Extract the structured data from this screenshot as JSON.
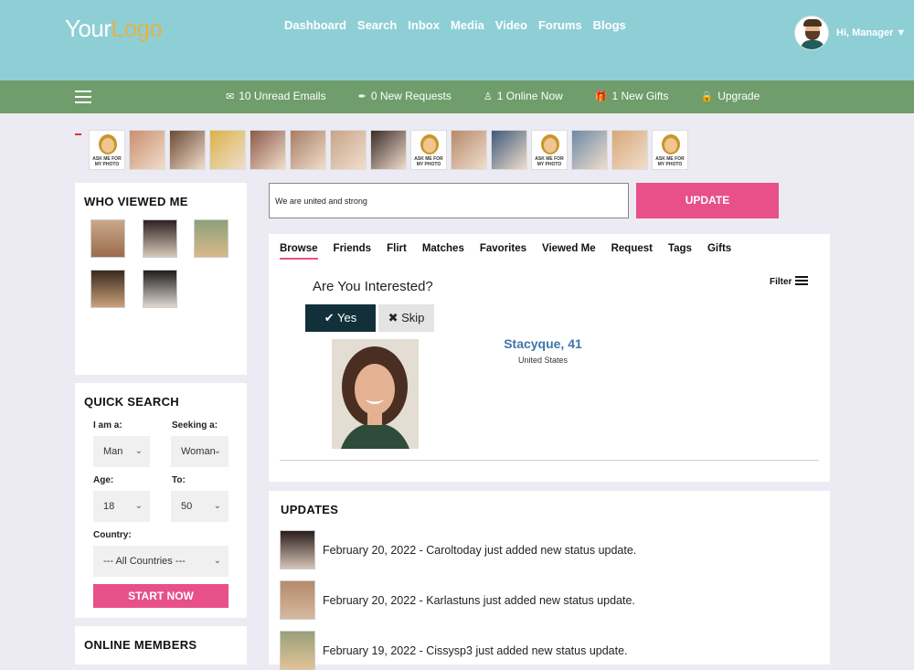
{
  "header": {
    "logo_a": "Your",
    "logo_b": "Logo",
    "nav": [
      "Dashboard",
      "Search",
      "Inbox",
      "Media",
      "Video",
      "Forums",
      "Blogs"
    ],
    "greeting": "Hi, Manager"
  },
  "subbar": {
    "stats": [
      {
        "icon": "✉",
        "icon_name": "mail-icon",
        "label": "10 Unread Emails"
      },
      {
        "icon": "✒",
        "icon_name": "pen-icon",
        "label": "0 New Requests"
      },
      {
        "icon": "♙",
        "icon_name": "person-icon",
        "label": "1 Online Now"
      },
      {
        "icon": "🎁",
        "icon_name": "gift-icon",
        "label": "1 New Gifts"
      },
      {
        "icon": "🔒",
        "icon_name": "lock-icon",
        "label": "Upgrade"
      }
    ]
  },
  "strip": {
    "ask_caption": "ASK ME FOR MY PHOTO",
    "items": [
      "ask",
      "p1",
      "p2",
      "p3",
      "p4",
      "p5",
      "p6",
      "p7",
      "ask",
      "p8",
      "p9",
      "ask",
      "p10",
      "p11",
      "ask"
    ]
  },
  "who_viewed": {
    "title": "WHO VIEWED ME"
  },
  "quick_search": {
    "title": "QUICK SEARCH",
    "i_am_label": "I am a:",
    "i_am_value": "Man",
    "seeking_label": "Seeking a:",
    "seeking_value": "Woman",
    "age_label": "Age:",
    "age_from": "18",
    "to_label": "To:",
    "age_to": "50",
    "country_label": "Country:",
    "country_value": "--- All Countries ---",
    "start_label": "START NOW"
  },
  "online_members": {
    "title": "ONLINE MEMBERS"
  },
  "status": {
    "value": "We are united and strong",
    "update_label": "UPDATE"
  },
  "browse": {
    "tabs": [
      "Browse",
      "Friends",
      "Flirt",
      "Matches",
      "Favorites",
      "Viewed Me",
      "Request",
      "Tags",
      "Gifts"
    ],
    "filter_label": "Filter",
    "question": "Are You Interested?",
    "yes_label": "Yes",
    "skip_label": "Skip",
    "profile_name": "Stacyque, 41",
    "profile_country": "United States"
  },
  "updates": {
    "title": "UPDATES",
    "items": [
      "February 20, 2022 - Caroltoday  just added new status update.",
      "February 20, 2022 - Karlastuns  just added new status update.",
      "February 19, 2022 - Cissysp3  just added new status update."
    ]
  },
  "colors": {
    "header": "#8ecfd6",
    "subbar": "#6f9d6b",
    "accent_pink": "#e8508a",
    "yes_button": "#12303a",
    "name_blue": "#3f75aa"
  }
}
